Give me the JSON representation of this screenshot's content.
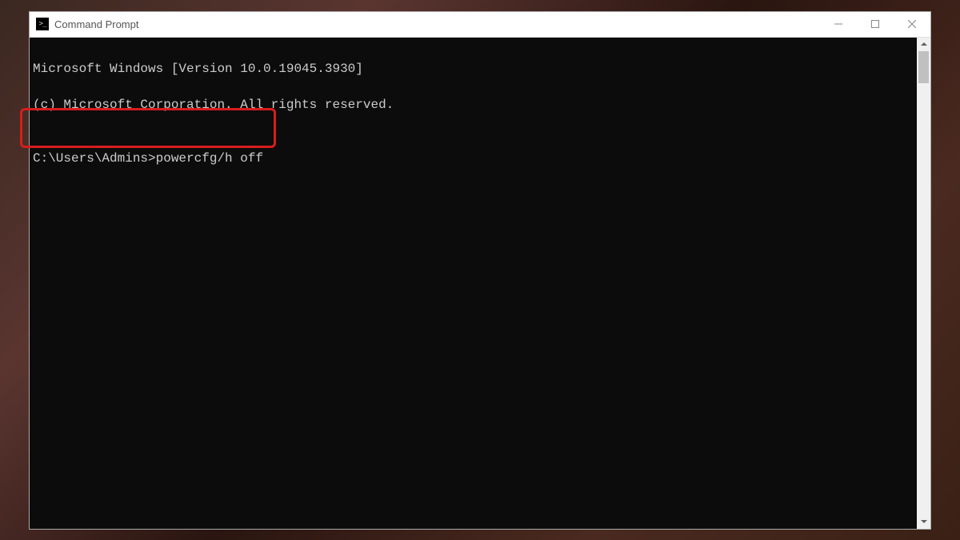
{
  "window": {
    "title": "Command Prompt"
  },
  "terminal": {
    "line1": "Microsoft Windows [Version 10.0.19045.3930]",
    "line2": "(c) Microsoft Corporation. All rights reserved.",
    "blank": "",
    "prompt": "C:\\Users\\Admins>",
    "command": "powercfg/h off"
  },
  "highlight": {
    "color": "#d91c1c"
  }
}
